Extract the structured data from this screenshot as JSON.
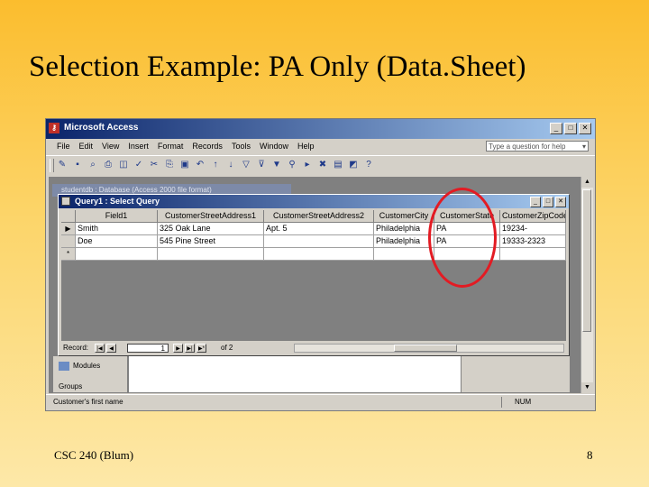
{
  "slide": {
    "title": "Selection Example: PA Only (Data.Sheet)",
    "footer_left": "CSC 240 (Blum)",
    "page_number": "8"
  },
  "app": {
    "title": "Microsoft Access",
    "menu": [
      "File",
      "Edit",
      "View",
      "Insert",
      "Format",
      "Records",
      "Tools",
      "Window",
      "Help"
    ],
    "help_placeholder": "Type a question for help",
    "toolbar_icons": [
      "view-icon",
      "save-icon",
      "search-icon",
      "print-icon",
      "preview-icon",
      "spelling-icon",
      "cut-icon",
      "copy-icon",
      "paste-icon",
      "undo-icon",
      "sort-asc-icon",
      "sort-desc-icon",
      "filter-icon",
      "filter-form-icon",
      "apply-filter-icon",
      "find-icon",
      "new-record-icon",
      "delete-record-icon",
      "database-window-icon",
      "new-object-icon",
      "help-icon"
    ]
  },
  "db_window": {
    "title": "studentdb : Database (Access 2000 file format)"
  },
  "query_window": {
    "title": "Query1 : Select Query",
    "columns": [
      "Field1",
      "CustomerStreetAddress1",
      "CustomerStreetAddress2",
      "CustomerCity",
      "CustomerState",
      "CustomerZipCode"
    ],
    "rows": [
      {
        "selector": "▶",
        "cells": [
          "Smith",
          "325 Oak Lane",
          "Apt. 5",
          "Philadelphia",
          "PA",
          "19234-"
        ]
      },
      {
        "selector": "",
        "cells": [
          "Doe",
          "545 Pine Street",
          "",
          "Philadelphia",
          "PA",
          "19333-2323"
        ]
      },
      {
        "selector": "*",
        "cells": [
          "",
          "",
          "",
          "",
          "",
          ""
        ]
      }
    ],
    "nav": {
      "label": "Record:",
      "current": "1",
      "total_text": "of  2"
    }
  },
  "objects": {
    "modules": "Modules",
    "groups": "Groups"
  },
  "status_bar": {
    "text": "Customer's first name",
    "num": "NUM"
  },
  "colors": {
    "highlight": "#e31b23",
    "title_bar": "#0a246a"
  }
}
